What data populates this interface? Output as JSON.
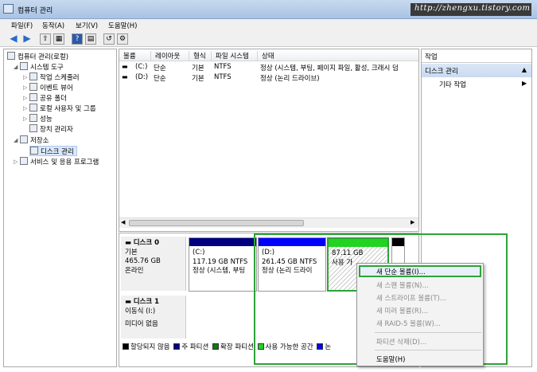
{
  "window": {
    "title": "컴퓨터 관리",
    "watermark": "http://zhengxu.tistory.com"
  },
  "menu": [
    "파일(F)",
    "동작(A)",
    "보기(V)",
    "도움말(H)"
  ],
  "tree": {
    "root": "컴퓨터 관리(로컬)",
    "system_tools": "시스템 도구",
    "task_scheduler": "작업 스케줄러",
    "event_viewer": "이벤트 뷰어",
    "shared_folders": "공유 폴더",
    "local_users": "로컬 사용자 및 그룹",
    "performance": "성능",
    "device_manager": "장치 관리자",
    "storage": "저장소",
    "disk_management": "디스크 관리",
    "services_apps": "서비스 및 응용 프로그램"
  },
  "list": {
    "columns": [
      "볼륨",
      "레이아웃",
      "형식",
      "파일 시스템",
      "상태"
    ],
    "rows": [
      {
        "volume": "(C:)",
        "layout": "단순",
        "type": "기본",
        "fs": "NTFS",
        "status": "정상 (시스템, 부팅, 페이지 파일, 활성, 크래시 덤"
      },
      {
        "volume": "(D:)",
        "layout": "단순",
        "type": "기본",
        "fs": "NTFS",
        "status": "정상 (논리 드라이브)"
      }
    ]
  },
  "disks": {
    "disk0": {
      "name": "디스크 0",
      "kind": "기본",
      "size": "465.76 GB",
      "state": "온라인"
    },
    "disk1": {
      "name": "디스크 1",
      "kind": "이동식 (I:)",
      "state": "미디어 없음"
    },
    "partitions": [
      {
        "label": "(C:)",
        "size": "117.19 GB NTFS",
        "status": "정상 (시스템, 부팅"
      },
      {
        "label": "(D:)",
        "size": "261.45 GB NTFS",
        "status": "정상 (논리 드라이"
      },
      {
        "label": "",
        "size": "87.11 GB",
        "status": "사용 가"
      }
    ]
  },
  "legend": [
    "할당되지 않음",
    "주 파티션",
    "확장 파티션",
    "사용 가능한 공간",
    "논"
  ],
  "colors": {
    "unallocated": "#000000",
    "primary": "#000080",
    "extended": "#0e7a0e",
    "free": "#22d322",
    "logical": "#0000ff"
  },
  "actions": {
    "header": "작업",
    "section": "디스크 관리",
    "more": "기타 작업"
  },
  "context_menu": {
    "new_simple": "새 단순 볼륨(I)...",
    "new_spanned": "새 스팬 볼륨(N)...",
    "new_striped": "새 스트라이프 볼륨(T)...",
    "new_mirror": "새 미러 볼륨(R)...",
    "new_raid5": "새 RAID-5 볼륨(W)...",
    "delete_partition": "파티션 삭제(D)...",
    "help": "도움말(H)"
  }
}
